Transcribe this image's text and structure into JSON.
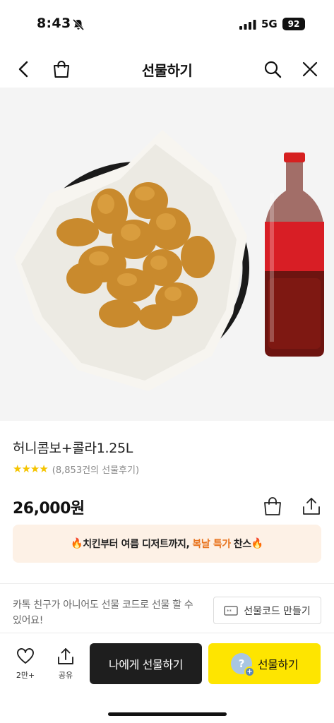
{
  "status_bar": {
    "time": "8:43",
    "network": "5G",
    "battery": "92",
    "icons": [
      "bell-slash-icon",
      "signal-icon"
    ]
  },
  "nav": {
    "title": "선물하기",
    "icons": [
      "back-icon",
      "shopping-bag-icon",
      "search-icon",
      "close-icon"
    ]
  },
  "product": {
    "image_label": "honey combo chicken with cola bottle",
    "name": "허니콤보+콜라1.25L",
    "stars": "★★★★",
    "review_count": "(8,853건의 선물후기)",
    "price": "26,000원"
  },
  "promo": {
    "flame": "🔥",
    "text_before": "치킨부터 여름 디저트까지,",
    "highlight": "복날 특가",
    "text_after": "찬스",
    "accent_color": "#e8731d",
    "background": "#fdf1e6"
  },
  "gift_code": {
    "description": "카톡 친구가 아니어도 선물 코드로 선물 할 수 있어요!",
    "button_label": "선물코드 만들기"
  },
  "bottom_bar": {
    "like_count": "2만+",
    "share_label": "공유",
    "gift_to_me_label": "나에게 선물하기",
    "gift_label": "선물하기",
    "gift_avatar_glyph": "?",
    "gift_avatar_plus": "+",
    "primary_color": "#fee500",
    "dark_color": "#1e1e1e"
  }
}
